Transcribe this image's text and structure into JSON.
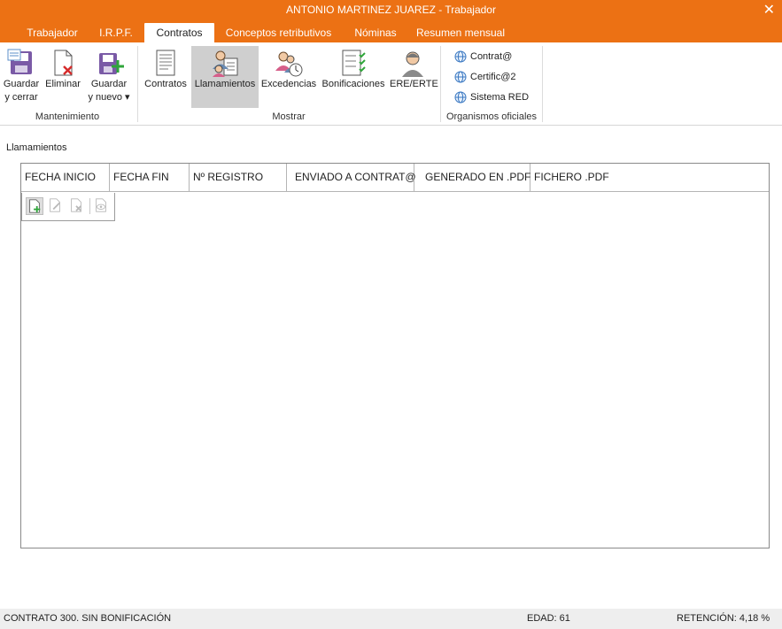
{
  "window": {
    "title": "ANTONIO MARTINEZ JUAREZ - Trabajador",
    "close_glyph": "✕"
  },
  "tabs": [
    {
      "label": "Trabajador",
      "active": false
    },
    {
      "label": "I.R.P.F.",
      "active": false
    },
    {
      "label": "Contratos",
      "active": true
    },
    {
      "label": "Conceptos retributivos",
      "active": false
    },
    {
      "label": "Nóminas",
      "active": false
    },
    {
      "label": "Resumen mensual",
      "active": false
    }
  ],
  "ribbon": {
    "groups": {
      "mantenimiento": "Mantenimiento",
      "mostrar": "Mostrar",
      "organismos": "Organismos oficiales"
    },
    "mantenimiento": {
      "guardar_cerrar_1": "Guardar",
      "guardar_cerrar_2": "y cerrar",
      "eliminar": "Eliminar",
      "guardar_nuevo_1": "Guardar",
      "guardar_nuevo_2": "y nuevo ▾"
    },
    "mostrar": {
      "contratos": "Contratos",
      "llamamientos": "Llamamientos",
      "excedencias": "Excedencias",
      "bonificaciones": "Bonificaciones",
      "ere_erte": "ERE/ERTE"
    },
    "organismos": {
      "contrata": "Contrat@",
      "certifica": "Certific@2",
      "sistema_red": "Sistema RED"
    }
  },
  "section": {
    "label": "Llamamientos"
  },
  "grid": {
    "columns": [
      "FECHA INICIO",
      "FECHA FIN",
      "Nº REGISTRO",
      "ENVIADO A CONTRAT@",
      "GENERADO EN .PDF",
      "FICHERO .PDF"
    ],
    "rows": []
  },
  "status": {
    "contrato": "CONTRATO 300.  SIN BONIFICACIÓN",
    "edad": "EDAD: 61",
    "retencion": "RETENCIÓN: 4,18 %"
  },
  "colors": {
    "accent": "#ec7114",
    "selected_bg": "#cfcfcf"
  }
}
